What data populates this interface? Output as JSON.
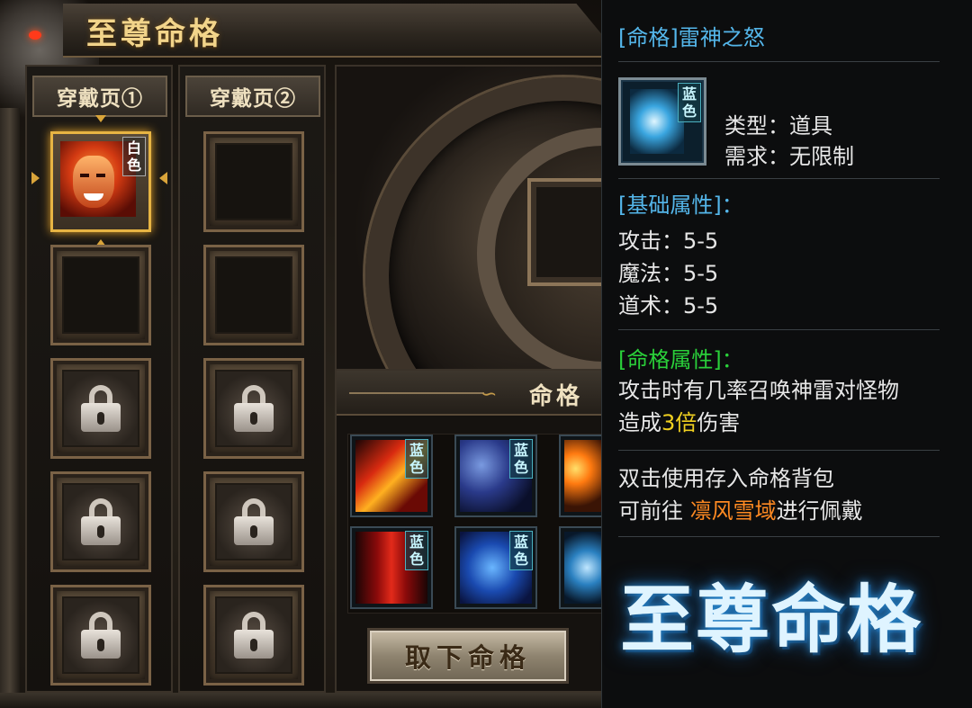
{
  "window": {
    "title": "至尊命格"
  },
  "pages": [
    {
      "label": "穿戴页①",
      "slots": [
        {
          "state": "equipped",
          "grade": "白色",
          "grade_color": "#ffffff"
        },
        {
          "state": "empty"
        },
        {
          "state": "locked"
        },
        {
          "state": "locked"
        },
        {
          "state": "locked"
        }
      ]
    },
    {
      "label": "穿戴页②",
      "slots": [
        {
          "state": "empty"
        },
        {
          "state": "empty"
        },
        {
          "state": "locked"
        },
        {
          "state": "locked"
        },
        {
          "state": "locked"
        }
      ]
    }
  ],
  "bag": {
    "title": "命格",
    "items": [
      {
        "grade": "蓝色",
        "icon": "lightning-red-icon"
      },
      {
        "grade": "蓝色",
        "icon": "blue-spirit-icon"
      },
      {
        "grade": "",
        "icon": "fire-silhouette-icon"
      },
      {
        "grade": "蓝色",
        "icon": "red-pillar-icon"
      },
      {
        "grade": "蓝色",
        "icon": "blue-beast-icon"
      },
      {
        "grade": "",
        "icon": "thunder-god-icon"
      }
    ],
    "remove_button": "取下命格"
  },
  "tooltip": {
    "title": "[命格]雷神之怒",
    "icon_grade": "蓝色",
    "type_line": "类型：道具",
    "require_line": "需求：无限制",
    "base_header": "[基础属性]：",
    "stats": [
      "攻击：5-5",
      "魔法：5-5",
      "道术：5-5"
    ],
    "special_header": "[命格属性]：",
    "desc_prefix": "攻击时有几率召唤神雷对怪物",
    "desc_mid": "造成",
    "desc_highlight": "3倍",
    "desc_suffix": "伤害",
    "hint_line1": "双击使用存入命格背包",
    "hint_prefix": "可前往 ",
    "hint_location": "凛风雪域",
    "hint_suffix": "进行佩戴",
    "brand": "至尊命格"
  },
  "colors": {
    "tooltip_title": "#54b6ea",
    "special_header": "#2ad03a",
    "highlight_gold": "#f0d020",
    "location_orange": "#ff8a22"
  }
}
